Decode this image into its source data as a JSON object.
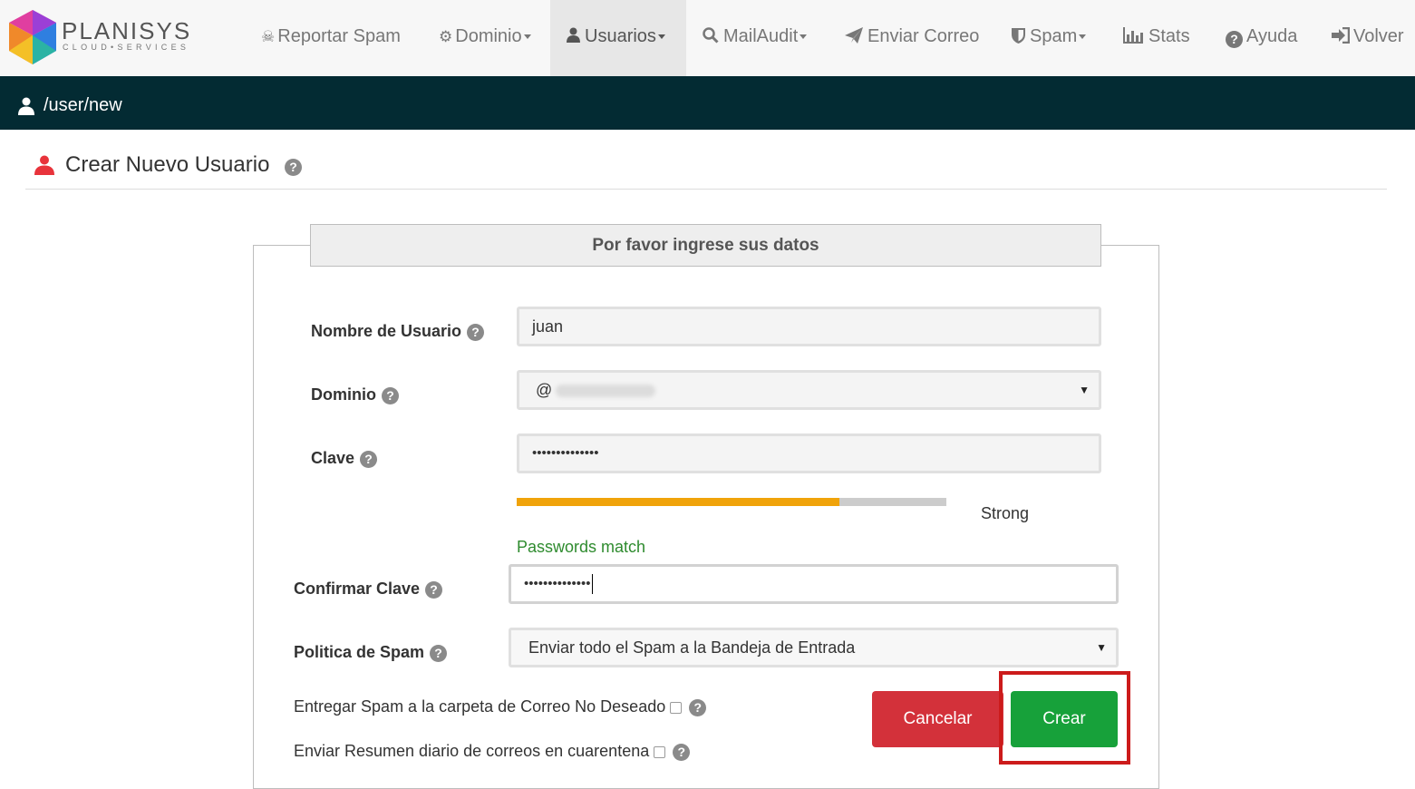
{
  "logo": {
    "name": "PLANISYS",
    "tagline": "CLOUD•SERVICES"
  },
  "nav": {
    "items": [
      {
        "label": "Reportar Spam",
        "icon": "skull-crossbones-icon"
      },
      {
        "label": "Dominio",
        "icon": "gear-icon"
      },
      {
        "label": "Usuarios",
        "icon": "user-icon"
      },
      {
        "label": "MailAudit",
        "icon": "search-icon"
      },
      {
        "label": "Enviar Correo",
        "icon": "paper-plane-icon"
      },
      {
        "label": "Spam",
        "icon": "shield-icon"
      },
      {
        "label": "Stats",
        "icon": "bar-chart-icon"
      },
      {
        "label": "Ayuda",
        "icon": "question-circle-icon"
      },
      {
        "label": "Volver",
        "icon": "sign-out-icon"
      }
    ],
    "active": "Usuarios"
  },
  "path": "/user/new",
  "page": {
    "title": "Crear Nuevo Usuario"
  },
  "form": {
    "legend": "Por favor ingrese sus datos",
    "username": {
      "label": "Nombre de Usuario",
      "value": "juan"
    },
    "domain": {
      "label": "Dominio",
      "prefix": "@"
    },
    "password": {
      "label": "Clave",
      "value": "••••••••••••••",
      "strength_text": "Strong",
      "strength_fraction": 0.75
    },
    "password_match_text": "Passwords match",
    "confirm": {
      "label": "Confirmar Clave",
      "value": "••••••••••••••"
    },
    "spam_policy": {
      "label": "Politica de Spam",
      "value": "Enviar todo el Spam a la Bandeja de Entrada"
    },
    "junk_checkbox": {
      "label": "Entregar Spam a la carpeta de Correo No Deseado",
      "checked": false
    },
    "digest_checkbox": {
      "label": "Enviar Resumen diario de correos en cuarentena",
      "checked": false
    },
    "cancel_label": "Cancelar",
    "create_label": "Crear"
  },
  "colors": {
    "navbar_bg": "#f7f7f7",
    "pathbar_bg": "#032b33",
    "cancel_button": "#d3313a",
    "create_button": "#17a13a",
    "strength_bar": "#f0a30a",
    "match_text": "#2e8b2e",
    "highlight_box": "#cc1b1b"
  }
}
